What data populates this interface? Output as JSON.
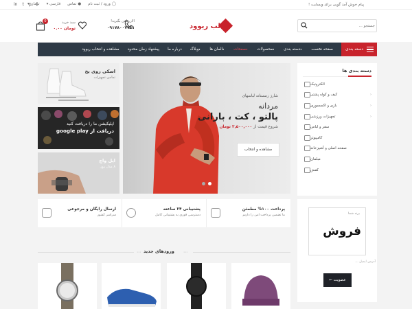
{
  "topbar": {
    "welcome": "پیام خوش آمد گویی برای وبسایت !",
    "login": "ورود / ثبت نام",
    "contact": "تماس",
    "language": "فارسی",
    "currency": "تومان",
    "social": [
      "facebook-icon",
      "pinterest-icon",
      "twitter-icon",
      "linkedin-icon"
    ]
  },
  "header": {
    "search_placeholder": "جستجو ...",
    "logo_text": "قالب ریوود",
    "phone_label": "الان تلفن بگیرید!",
    "phone_number": "۰۹۱۷۸۰۰۷۷۶۱",
    "cart_label": "سبد خرید",
    "cart_total": "تومان ۰.۰۰",
    "cart_count": "0"
  },
  "nav": {
    "categories_button": "دسته بندی",
    "items": [
      {
        "label": "صفحه نخست",
        "has_menu": false,
        "active": false
      },
      {
        "label": "دسته بندی",
        "has_menu": true,
        "active": false
      },
      {
        "label": "محصولات",
        "has_menu": true,
        "active": false
      },
      {
        "label": "صفحات",
        "has_menu": true,
        "active": true
      },
      {
        "label": "المان ها",
        "has_menu": true,
        "active": false
      },
      {
        "label": "وبلاگ",
        "has_menu": true,
        "active": false
      },
      {
        "label": "درباره ما",
        "has_menu": false,
        "active": false
      },
      {
        "label": "پیشنهاد زمان محدود",
        "has_menu": false,
        "active": false
      },
      {
        "label": "مشاهده و انتخاب ریوود",
        "has_menu": false,
        "active": false
      }
    ]
  },
  "sidebar": {
    "title": "دسته بندی ها",
    "items": [
      {
        "label": "الکترونیک",
        "arrow": false
      },
      {
        "label": "کیف و کوله پشتی",
        "arrow": true
      },
      {
        "label": "بازی و اکسسوری",
        "arrow": true
      },
      {
        "label": "تجهیزات ورزشی",
        "arrow": true
      },
      {
        "label": "سفر و لباس",
        "arrow": false
      },
      {
        "label": "کامپیوتر",
        "arrow": false
      },
      {
        "label": "صفحه اصلی و آشپزخانه",
        "arrow": false
      },
      {
        "label": "مبلمان",
        "arrow": false
      },
      {
        "label": "کفش",
        "arrow": false
      }
    ]
  },
  "hero": {
    "subtitle": "شارژ زمستانه لباسهای",
    "line1": "مردانه",
    "line2": "پالتو ، کت ، بارانی",
    "price_prefix": "شروع قیمت از",
    "price": "۲,۵۰۰,۰۰۰ تومان",
    "button": "مشاهده و انتخاب"
  },
  "promos": [
    {
      "title": "اسکی روی یخ",
      "subtitle": "تمامی تجهیزات"
    },
    {
      "title": "اپلیکیشن ما را دریافت کنید",
      "subtitle": "دریافت از google play"
    },
    {
      "title": "اپل واچ",
      "subtitle": "۸ مدل روز"
    }
  ],
  "features": [
    {
      "title": "پرداخت ۱۰۰% مطمئن",
      "subtitle": "ما تضمین پرداخت امن را داریم"
    },
    {
      "title": "پشتیبانی ۲۴ ساعته",
      "subtitle": "دسترسی فوری به پشتیبانی کامل"
    },
    {
      "title": "ارسال رایگان و مرجوعی",
      "subtitle": "سراسر کشور"
    }
  ],
  "newsletter": {
    "small": "برند شما",
    "big": "فروش",
    "email_placeholder": "آدرس ایمیل ...",
    "button": "عضویت"
  },
  "newest": {
    "title": "ورودهای جدید"
  },
  "colors": {
    "accent": "#c8232c",
    "nav_bg": "#2e3a46",
    "button_dark": "#1f2228"
  }
}
